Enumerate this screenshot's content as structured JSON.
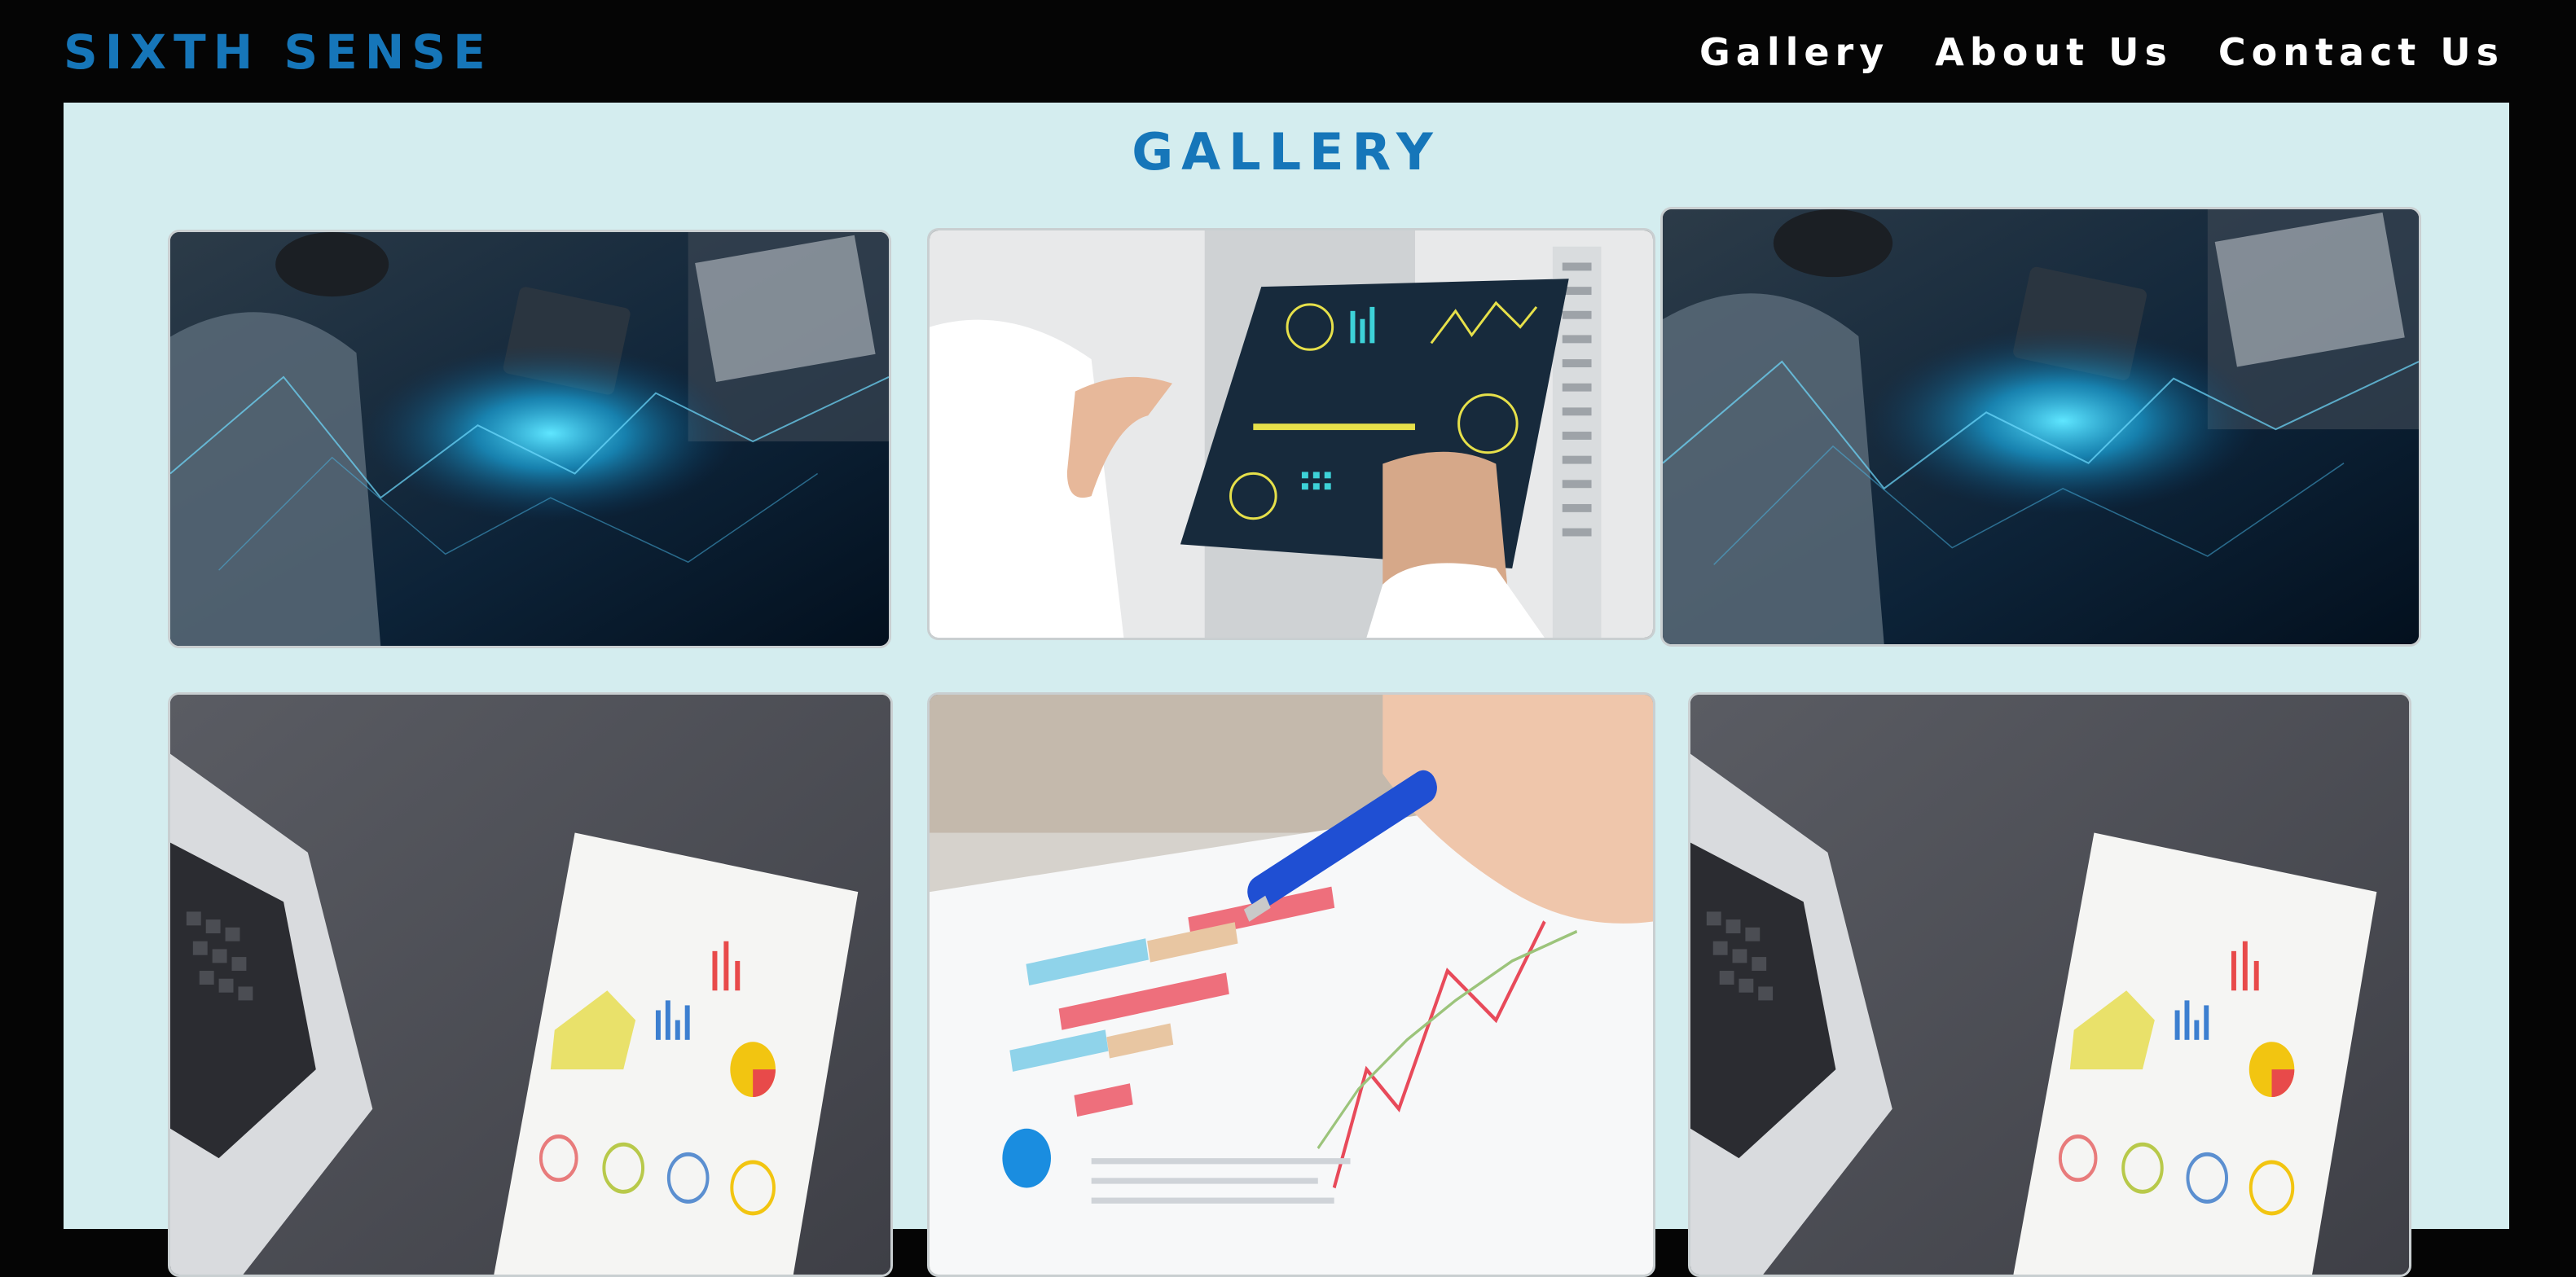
{
  "brand": {
    "name": "SIXTH SENSE"
  },
  "nav": {
    "items": [
      {
        "label": "Gallery"
      },
      {
        "label": "About Us"
      },
      {
        "label": "Contact Us"
      }
    ]
  },
  "gallery": {
    "title": "GALLERY",
    "images": [
      {
        "subject": "woman using a tablet with glowing blue data network"
      },
      {
        "subject": "hands holding a transparent analytics dashboard tablet"
      },
      {
        "subject": "woman using a tablet with glowing blue data network"
      },
      {
        "subject": "laptop beside printed chart report on dark desk"
      },
      {
        "subject": "hand with blue pen pointing at bar and line chart printout"
      },
      {
        "subject": "laptop beside printed chart report on dark desk"
      }
    ]
  },
  "colors": {
    "background": "#050505",
    "content_background": "#d4edef",
    "accent": "#1676b9",
    "nav_text": "#ffffff"
  }
}
